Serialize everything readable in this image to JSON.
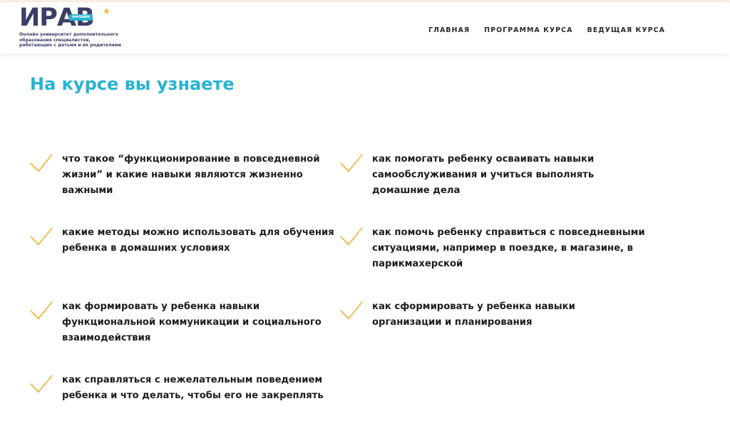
{
  "header": {
    "logo": {
      "word": "ИРАВ",
      "badge": "онлайн",
      "caption_lines": [
        "Онлайн университет дополнительного",
        "образования специалистов,",
        "работающих с детьми и их родителями"
      ]
    },
    "nav": [
      {
        "label": "ГЛАВНАЯ"
      },
      {
        "label": "ПРОГРАММА КУРСА"
      },
      {
        "label": "ВЕДУЩАЯ КУРСА"
      }
    ]
  },
  "section": {
    "title": "На курсе вы узнаете",
    "items": [
      {
        "lines": [
          "что такое “функционирование в повседневной",
          "жизни” и какие навыки являются жизненно",
          "важными"
        ]
      },
      {
        "lines": [
          "как помогать ребенку осваивать навыки",
          "самообслуживания и учиться выполнять",
          "домашние дела"
        ]
      },
      {
        "lines": [
          "какие методы можно использовать для обучения",
          "ребенка в домашних условиях"
        ]
      },
      {
        "lines": [
          "как помочь ребенку справиться с повседневными",
          "ситуациями, например в поездке, в магазине, в",
          "парикмахерской"
        ]
      },
      {
        "lines": [
          "как формировать у ребенка навыки",
          "функциональной коммуникации и социального",
          "взаимодействия"
        ]
      },
      {
        "lines": [
          "как сформировать у ребенка навыки",
          "организации и планирования"
        ]
      },
      {
        "lines": [
          "как справляться с нежелательным поведением",
          "ребенка и что делать, чтобы его не закреплять"
        ]
      }
    ]
  },
  "colors": {
    "accent": "#27b3d2",
    "logo": "#3b3e66",
    "check": "#f0b94a",
    "text": "#1d1d1f"
  },
  "icons": {
    "item_marker": "checkmark-icon",
    "logo_mark": "star-icon"
  }
}
